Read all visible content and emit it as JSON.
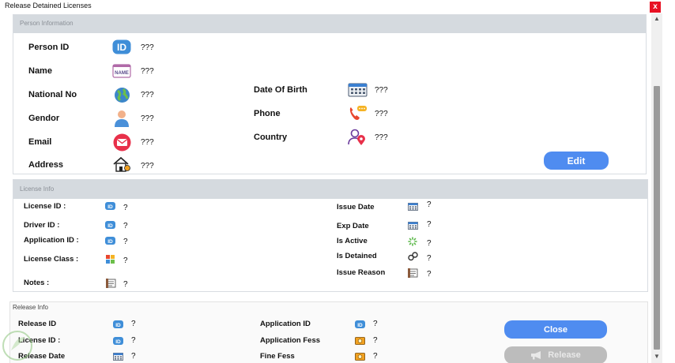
{
  "window": {
    "title": "Release Detained Licenses",
    "close_glyph": "x"
  },
  "colors": {
    "accent_blue": "#4f8cf0",
    "header_gray": "#d5dadf",
    "disabled_gray": "#bcbcbc",
    "close_red": "#e81123"
  },
  "person": {
    "header": "Person Information",
    "person_id": {
      "label": "Person ID",
      "value": "???",
      "icon": "id-badge-icon"
    },
    "name": {
      "label": "Name",
      "value": "???",
      "icon": "name-tag-icon"
    },
    "national_no": {
      "label": "National No",
      "value": "???",
      "icon": "globe-icon"
    },
    "gendor": {
      "label": "Gendor",
      "value": "???",
      "icon": "person-icon"
    },
    "email": {
      "label": "Email",
      "value": "???",
      "icon": "email-icon"
    },
    "address": {
      "label": "Address",
      "value": "???",
      "icon": "house-icon"
    },
    "date_of_birth": {
      "label": "Date Of Birth",
      "value": "???",
      "icon": "calendar-icon"
    },
    "phone": {
      "label": "Phone",
      "value": "???",
      "icon": "phone-icon"
    },
    "country": {
      "label": "Country",
      "value": "???",
      "icon": "location-icon"
    },
    "edit_label": "Edit"
  },
  "license": {
    "header": "License Info",
    "license_id": {
      "label": "License ID :",
      "value": "?"
    },
    "driver_id": {
      "label": "Driver ID :",
      "value": "?"
    },
    "application_id": {
      "label": "Application ID :",
      "value": "?"
    },
    "license_class": {
      "label": "License Class :",
      "value": "?"
    },
    "notes": {
      "label": "Notes :",
      "value": "?"
    },
    "issue_date": {
      "label": "Issue Date",
      "value": "?"
    },
    "exp_date": {
      "label": "Exp Date",
      "value": "?"
    },
    "is_active": {
      "label": "Is Active",
      "value": "?"
    },
    "is_detained": {
      "label": "Is Detained",
      "value": "?"
    },
    "issue_reason": {
      "label": "Issue Reason",
      "value": "?"
    }
  },
  "release": {
    "header": "Release Info",
    "release_id": {
      "label": "Release ID",
      "value": "?"
    },
    "license_id": {
      "label": "License ID :",
      "value": "?"
    },
    "release_date": {
      "label": "Release  Date",
      "value": "?"
    },
    "application_id": {
      "label": "Application ID",
      "value": "?"
    },
    "application_fess": {
      "label": "Application Fess",
      "value": "?"
    },
    "fine_fess": {
      "label": "Fine Fess",
      "value": "?"
    },
    "close_label": "Close",
    "release_label": "Release"
  }
}
